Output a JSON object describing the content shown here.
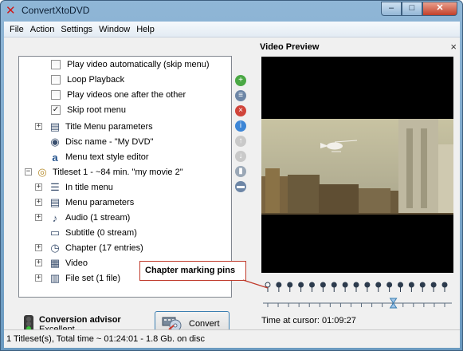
{
  "window": {
    "title": "ConvertXtoDVD",
    "app_icon_glyph": "✕",
    "minimize_glyph": "–",
    "maximize_glyph": "□",
    "close_glyph": "✕"
  },
  "menu": [
    "File",
    "Action",
    "Settings",
    "Window",
    "Help"
  ],
  "tree": {
    "items": [
      {
        "label": "Play video automatically (skip menu)",
        "kind": "checkbox",
        "checked": false,
        "icon": ""
      },
      {
        "label": "Loop Playback",
        "kind": "checkbox",
        "checked": false,
        "icon": ""
      },
      {
        "label": "Play videos one after the other",
        "kind": "checkbox",
        "checked": false,
        "icon": ""
      },
      {
        "label": "Skip root menu",
        "kind": "checkbox",
        "checked": true,
        "icon": ""
      },
      {
        "label": "Title Menu parameters",
        "kind": "node",
        "expander": "+",
        "icon": "menu-settings-icon"
      },
      {
        "label": "Disc name - \"My DVD\"",
        "kind": "leaf",
        "icon": "disc-icon"
      },
      {
        "label": "Menu text style editor",
        "kind": "leaf",
        "icon": "font-style-icon"
      },
      {
        "label": "Titleset 1 - ~84 min. \"my movie 2\"",
        "kind": "titleset",
        "expander": "−",
        "icon": "titleset-disc-icon"
      },
      {
        "label": "In title menu",
        "kind": "node",
        "expander": "+",
        "icon": "list-icon"
      },
      {
        "label": "Menu parameters",
        "kind": "node",
        "expander": "+",
        "icon": "menu-settings-icon"
      },
      {
        "label": "Audio (1 stream)",
        "kind": "node",
        "expander": "+",
        "icon": "music-note-icon"
      },
      {
        "label": "Subtitle (0 stream)",
        "kind": "leaf",
        "icon": "subtitle-icon"
      },
      {
        "label": "Chapter (17 entries)",
        "kind": "node",
        "expander": "+",
        "icon": "clock-icon"
      },
      {
        "label": "Video",
        "kind": "node",
        "expander": "+",
        "icon": "film-icon"
      },
      {
        "label": "File set (1 file)",
        "kind": "node",
        "expander": "+",
        "icon": "file-set-icon"
      }
    ],
    "scroll_up_glyph": "▲",
    "scroll_down_glyph": "▼"
  },
  "side_toolbar": [
    {
      "name": "add-icon",
      "glyph": "+",
      "color": "#4aa844"
    },
    {
      "name": "copy-icon",
      "glyph": "≡",
      "color": "#6d86a6"
    },
    {
      "name": "remove-icon",
      "glyph": "×",
      "color": "#d0443a"
    },
    {
      "name": "info-icon",
      "glyph": "i",
      "color": "#3d86d6"
    },
    {
      "name": "move-up-icon",
      "glyph": "↑",
      "color": "#c9c9c9"
    },
    {
      "name": "move-down-icon",
      "glyph": "↓",
      "color": "#c9c9c9"
    },
    {
      "name": "trash-icon",
      "glyph": "▮",
      "color": "#9aa7b6"
    },
    {
      "name": "screen-icon",
      "glyph": "▬",
      "color": "#6d86a6"
    }
  ],
  "advisor": {
    "title": "Conversion advisor",
    "value": "Excellent"
  },
  "convert_button": {
    "label": "Convert"
  },
  "video_preview": {
    "title": "Video Preview",
    "close_glyph": "×",
    "chapter_pin_count": 17,
    "cursor_position": 0.71,
    "cursor_text": "Time at cursor: 01:09:27"
  },
  "callout": {
    "text": "Chapter marking pins"
  },
  "status": {
    "text": "1 Titleset(s), Total time ~ 01:24:01 - 1.8 Gb. on disc"
  },
  "colors": {
    "accent": "#3c7fb1",
    "callout_border": "#c03a2b",
    "pin": "#2c3b4d"
  }
}
